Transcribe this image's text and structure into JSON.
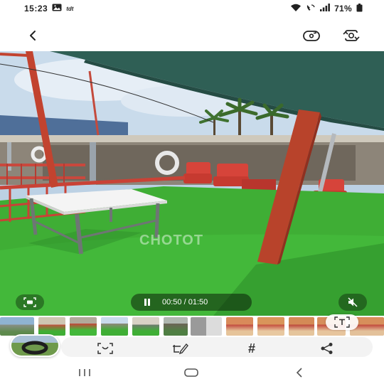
{
  "status_bar": {
    "time": "15:23",
    "carrier_badge": "tdt",
    "battery_percent": "71%",
    "icons": [
      "gallery-icon",
      "wifi-icon",
      "wifi-calling-icon",
      "signal-icon",
      "battery-icon"
    ]
  },
  "app_bar": {
    "icons": [
      "back-arrow-icon",
      "switch-camera-icon",
      "remaster-icon"
    ]
  },
  "video": {
    "watermark": "CHOTOT",
    "elapsed": "00:50",
    "separator": "/",
    "duration": "01:50",
    "progress_fraction": 0.4545,
    "icons": [
      "capture-icon",
      "pause-icon",
      "mute-icon"
    ]
  },
  "filmstrip": {
    "thumbnail_count": 12,
    "active_index": 0,
    "text_extract_icon": "text-extract-icon"
  },
  "action_bar": {
    "icons": [
      "crop-auto-icon",
      "edit-icon",
      "hashtag-icon",
      "share-icon"
    ]
  },
  "nav_bar": {
    "icons": [
      "recents-icon",
      "home-icon",
      "back-icon"
    ]
  },
  "colors": {
    "grass": "#3fae35",
    "post_red": "#b8432b",
    "canopy": "#2f5f55",
    "chair_red": "#d6443a",
    "table_top": "#f4f4f4"
  }
}
